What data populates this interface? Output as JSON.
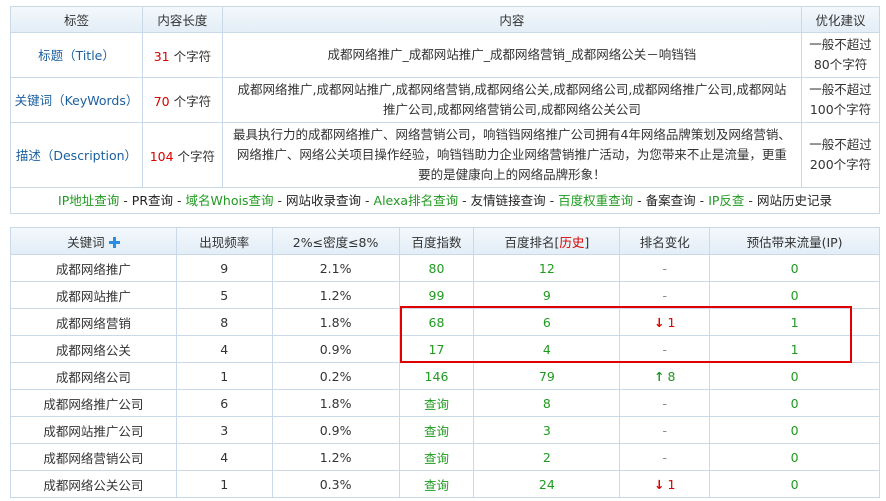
{
  "seo_table": {
    "headers": [
      "标签",
      "内容长度",
      "内容",
      "优化建议"
    ],
    "rows": [
      {
        "label": "标题（Title）",
        "length": "31",
        "unit": "个字符",
        "content": "成都网络推广_成都网站推广_成都网络营销_成都网络公关－响铛铛",
        "advice": "一般不超过80个字符"
      },
      {
        "label": "关键词（KeyWords）",
        "length": "70",
        "unit": "个字符",
        "content": "成都网络推广,成都网站推广,成都网络营销,成都网络公关,成都网络公司,成都网络推广公司,成都网站推广公司,成都网络营销公司,成都网络公关公司",
        "advice": "一般不超过100个字符"
      },
      {
        "label": "描述（Description）",
        "length": "104",
        "unit": "个字符",
        "content": "最具执行力的成都网络推广、网络营销公司，响铛铛网络推广公司拥有4年网络品牌策划及网络营销、网络推广、网络公关项目操作经验，响铛铛助力企业网络营销推广活动，为您带来不止是流量，更重要的是健康向上的网络品牌形象！",
        "advice": "一般不超过200个字符"
      }
    ],
    "links": [
      "IP地址查询",
      "PR查询",
      "域名Whois查询",
      "网站收录查询",
      "Alexa排名查询",
      "友情链接查询",
      "百度权重查询",
      "备案查询",
      "IP反查",
      "网站历史记录"
    ],
    "link_sep": "-"
  },
  "kw_table": {
    "headers": {
      "keyword": "关键词",
      "freq": "出现频率",
      "density": "2%≤密度≤8%",
      "index": "百度指数",
      "rank_prefix": "百度排名[",
      "rank_history": "历史",
      "rank_suffix": "]",
      "change": "排名变化",
      "traffic": "预估带来流量(IP)"
    },
    "rows": [
      {
        "keyword": "成都网络推广",
        "freq": "9",
        "density": "2.1%",
        "index": "80",
        "rank": "12",
        "change": "-",
        "change_dir": "none",
        "traffic": "0"
      },
      {
        "keyword": "成都网站推广",
        "freq": "5",
        "density": "1.2%",
        "index": "99",
        "rank": "9",
        "change": "-",
        "change_dir": "none",
        "traffic": "0"
      },
      {
        "keyword": "成都网络营销",
        "freq": "8",
        "density": "1.8%",
        "index": "68",
        "rank": "6",
        "change": "1",
        "change_dir": "down",
        "traffic": "1"
      },
      {
        "keyword": "成都网络公关",
        "freq": "4",
        "density": "0.9%",
        "index": "17",
        "rank": "4",
        "change": "-",
        "change_dir": "none",
        "traffic": "1"
      },
      {
        "keyword": "成都网络公司",
        "freq": "1",
        "density": "0.2%",
        "index": "146",
        "rank": "79",
        "change": "8",
        "change_dir": "up",
        "traffic": "0"
      },
      {
        "keyword": "成都网络推广公司",
        "freq": "6",
        "density": "1.8%",
        "index": "查询",
        "rank": "8",
        "change": "-",
        "change_dir": "none",
        "traffic": "0"
      },
      {
        "keyword": "成都网站推广公司",
        "freq": "3",
        "density": "0.9%",
        "index": "查询",
        "rank": "3",
        "change": "-",
        "change_dir": "none",
        "traffic": "0"
      },
      {
        "keyword": "成都网络营销公司",
        "freq": "4",
        "density": "1.2%",
        "index": "查询",
        "rank": "2",
        "change": "-",
        "change_dir": "none",
        "traffic": "0"
      },
      {
        "keyword": "成都网络公关公司",
        "freq": "1",
        "density": "0.3%",
        "index": "查询",
        "rank": "24",
        "change": "1",
        "change_dir": "down",
        "traffic": "0"
      }
    ]
  },
  "colors": {
    "link_blue": "#1a5f9e",
    "value_green": "#1f9a1f",
    "value_red": "#d90000",
    "highlight_border": "#e00000",
    "border": "#c9d9e7"
  }
}
